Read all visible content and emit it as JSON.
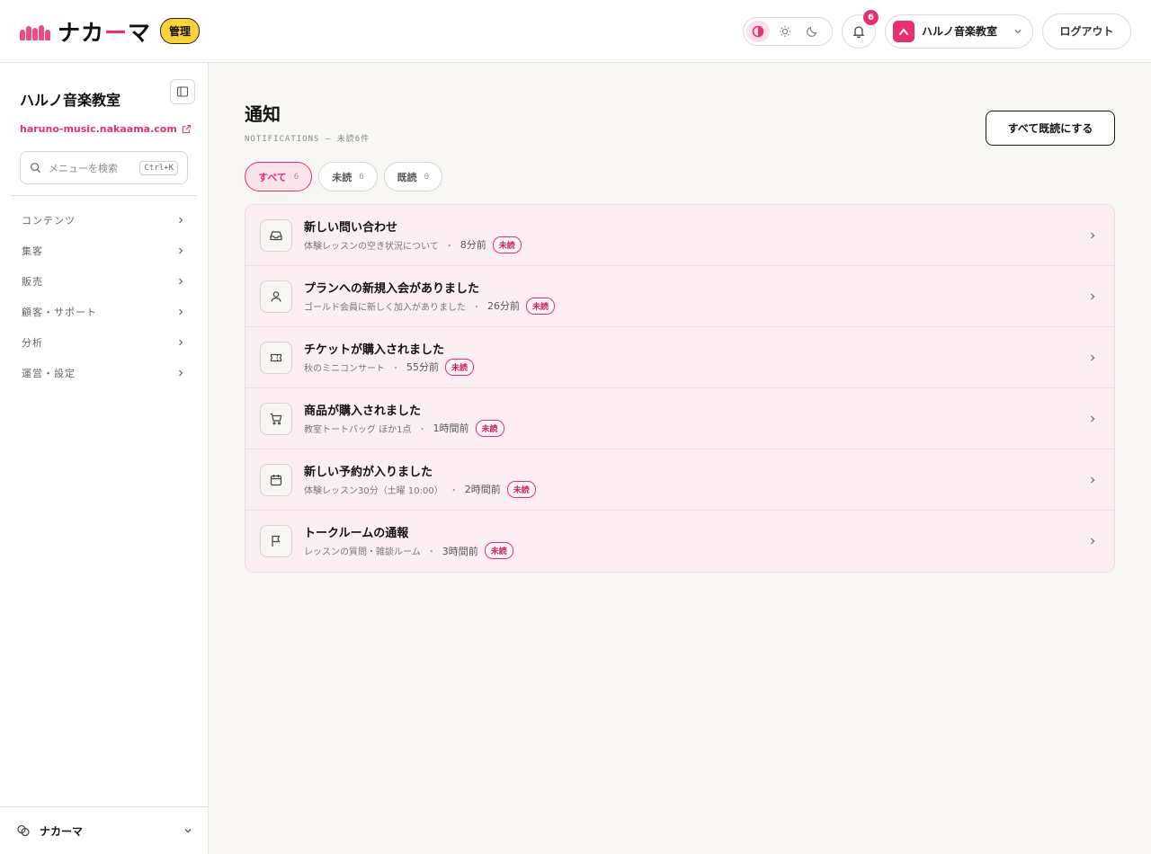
{
  "header": {
    "logo": {
      "text_main": "ナカ",
      "text_accent": "ー",
      "text_end": "マ"
    },
    "admin_badge": "管理",
    "theme": {
      "options": [
        "contrast-icon",
        "sun-icon",
        "moon-icon"
      ],
      "active": "contrast-icon"
    },
    "notifications_count": "6",
    "account_name": "ハルノ音楽教室",
    "logout_label": "ログアウト"
  },
  "sidebar": {
    "site_name": "ハルノ音楽教室",
    "site_url": "haruno-music.nakaama.com",
    "search": {
      "placeholder": "メニューを検索",
      "shortcut": "Ctrl+K"
    },
    "items": [
      {
        "label": "コンテンツ"
      },
      {
        "label": "集客"
      },
      {
        "label": "販売"
      },
      {
        "label": "顧客・サポート"
      },
      {
        "label": "分析"
      },
      {
        "label": "運営・設定"
      }
    ],
    "footer_label": "ナカーマ"
  },
  "main": {
    "title": "通知",
    "subtitle": "NOTIFICATIONS — 未読6件",
    "mark_all_label": "すべて既読にする",
    "tabs": [
      {
        "label": "すべて",
        "count": "6",
        "active": true
      },
      {
        "label": "未読",
        "count": "6",
        "active": false
      },
      {
        "label": "既読",
        "count": "0",
        "active": false
      }
    ],
    "notifications": [
      {
        "icon": "inbox-icon",
        "title": "新しい問い合わせ",
        "detail": "体験レッスンの空き状況について",
        "time": "8分前",
        "badge": "未読"
      },
      {
        "icon": "user-icon",
        "title": "プランへの新規入会がありました",
        "detail": "ゴールド会員に新しく加入がありました",
        "time": "26分前",
        "badge": "未読"
      },
      {
        "icon": "ticket-icon",
        "title": "チケットが購入されました",
        "detail": "秋のミニコンサート",
        "time": "55分前",
        "badge": "未読"
      },
      {
        "icon": "cart-icon",
        "title": "商品が購入されました",
        "detail": "教室トートバッグ ほか1点",
        "time": "1時間前",
        "badge": "未読"
      },
      {
        "icon": "calendar-icon",
        "title": "新しい予約が入りました",
        "detail": "体験レッスン30分（土曜 10:00）",
        "time": "2時間前",
        "badge": "未読"
      },
      {
        "icon": "flag-icon",
        "title": "トークルームの通報",
        "detail": "レッスンの質問・雑談ルーム",
        "time": "3時間前",
        "badge": "未読"
      }
    ]
  },
  "colors": {
    "accent": "#e8306f",
    "badge_yellow": "#fcd23b",
    "unread_row_bg": "#fdeef4",
    "main_bg": "#f8f7f4"
  }
}
